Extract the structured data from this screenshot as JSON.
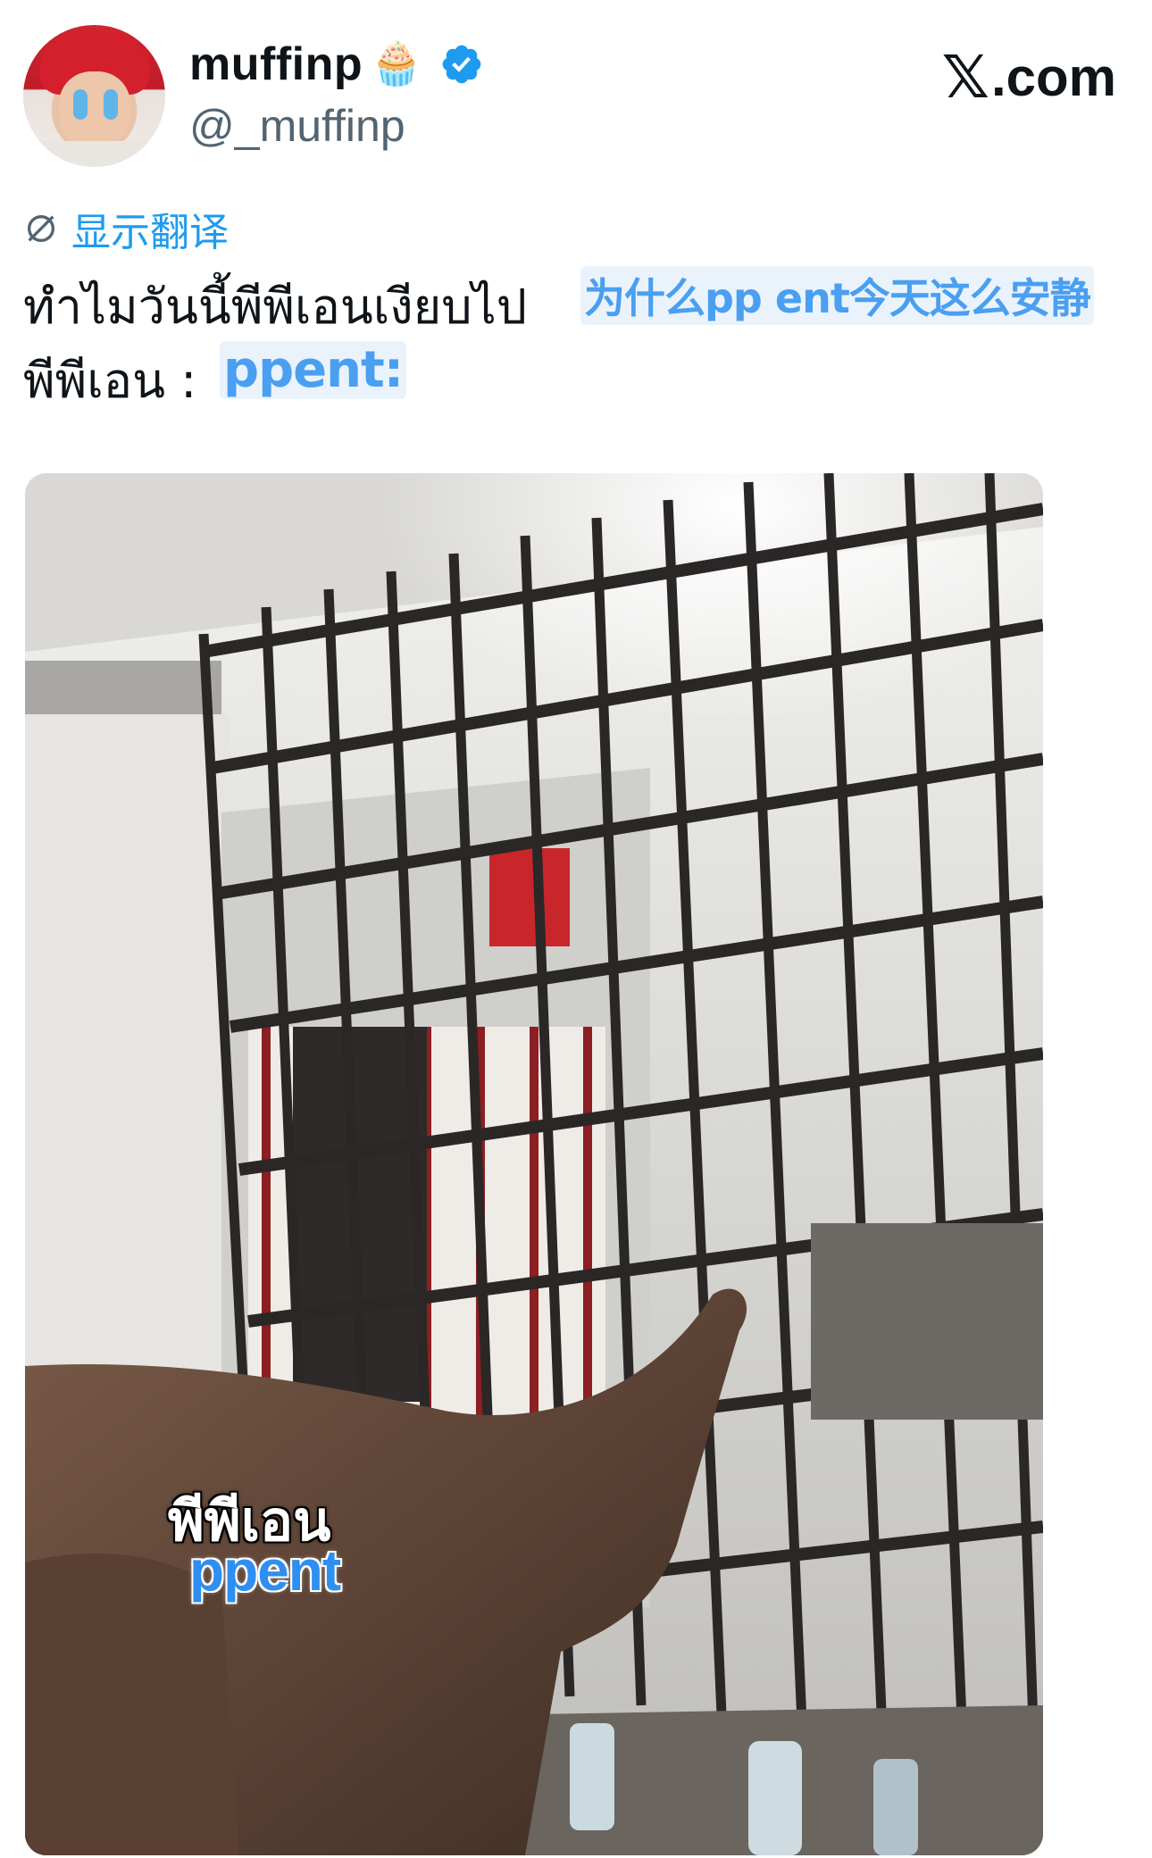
{
  "header": {
    "display_name": "muffinp",
    "name_emoji": "🧁",
    "handle": "@_muffinp",
    "brand": "com",
    "brand_mark": "𝕏",
    "brand_dot": "."
  },
  "translate": {
    "icon": "globe-icon",
    "label": "显示翻译"
  },
  "tweet": {
    "line1": "ทำไมวันนี้พีพีเอนเงียบไป",
    "line2": "พีพีเอน :",
    "line1_overlay_translation": "为什么pp ent今天这么安静",
    "line2_overlay_translation": "ppent:"
  },
  "media": {
    "caption_thai": "พีพีเอน",
    "caption_overlay": "ppent"
  },
  "colors": {
    "accent": "#1d9bf0",
    "overlay_text": "#4a9ff0",
    "handle_gray": "#536471"
  }
}
